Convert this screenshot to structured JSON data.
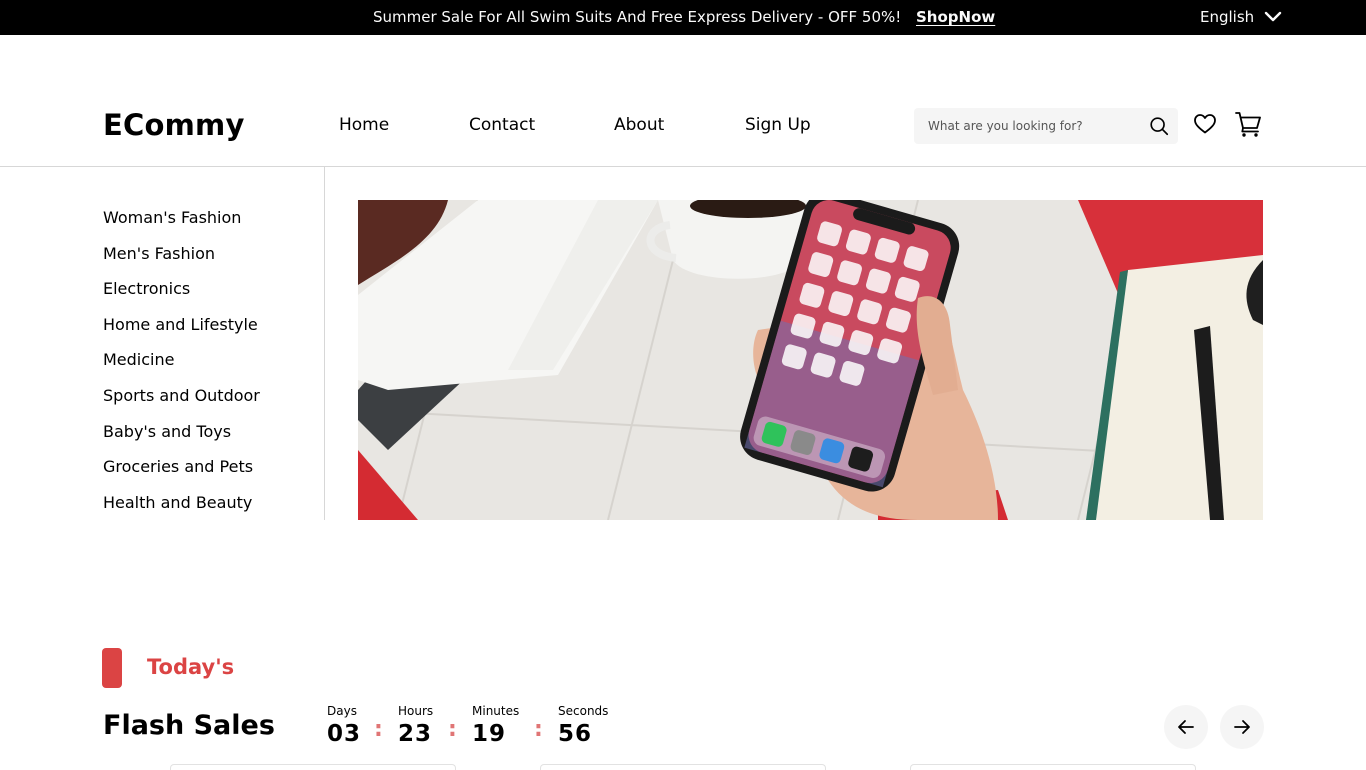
{
  "topbar": {
    "promo_text": "Summer Sale For All Swim Suits And Free Express Delivery - OFF 50%!",
    "shop_now": "ShopNow",
    "language": "English"
  },
  "header": {
    "logo": "ECommy",
    "nav": [
      {
        "label": "Home"
      },
      {
        "label": "Contact"
      },
      {
        "label": "About"
      },
      {
        "label": "Sign Up"
      }
    ],
    "search_placeholder": "What are you looking for?",
    "icons": [
      "search-icon",
      "heart-icon",
      "cart-icon"
    ]
  },
  "sidebar": {
    "items": [
      {
        "label": "Woman's Fashion"
      },
      {
        "label": "Men's Fashion"
      },
      {
        "label": "Electronics"
      },
      {
        "label": "Home and Lifestyle"
      },
      {
        "label": "Medicine"
      },
      {
        "label": "Sports and Outdoor"
      },
      {
        "label": "Baby's and Toys"
      },
      {
        "label": "Groceries and Pets"
      },
      {
        "label": "Health and Beauty"
      }
    ]
  },
  "flash_sales": {
    "tag": "Today's",
    "title": "Flash Sales",
    "countdown": [
      {
        "label": "Days",
        "value": "03"
      },
      {
        "label": "Hours",
        "value": "23"
      },
      {
        "label": "Minutes",
        "value": "19"
      },
      {
        "label": "Seconds",
        "value": "56"
      }
    ],
    "colon": ":"
  },
  "colors": {
    "accent": "#DB4444",
    "topbar_bg": "#000000",
    "search_bg": "#F5F5F5"
  }
}
